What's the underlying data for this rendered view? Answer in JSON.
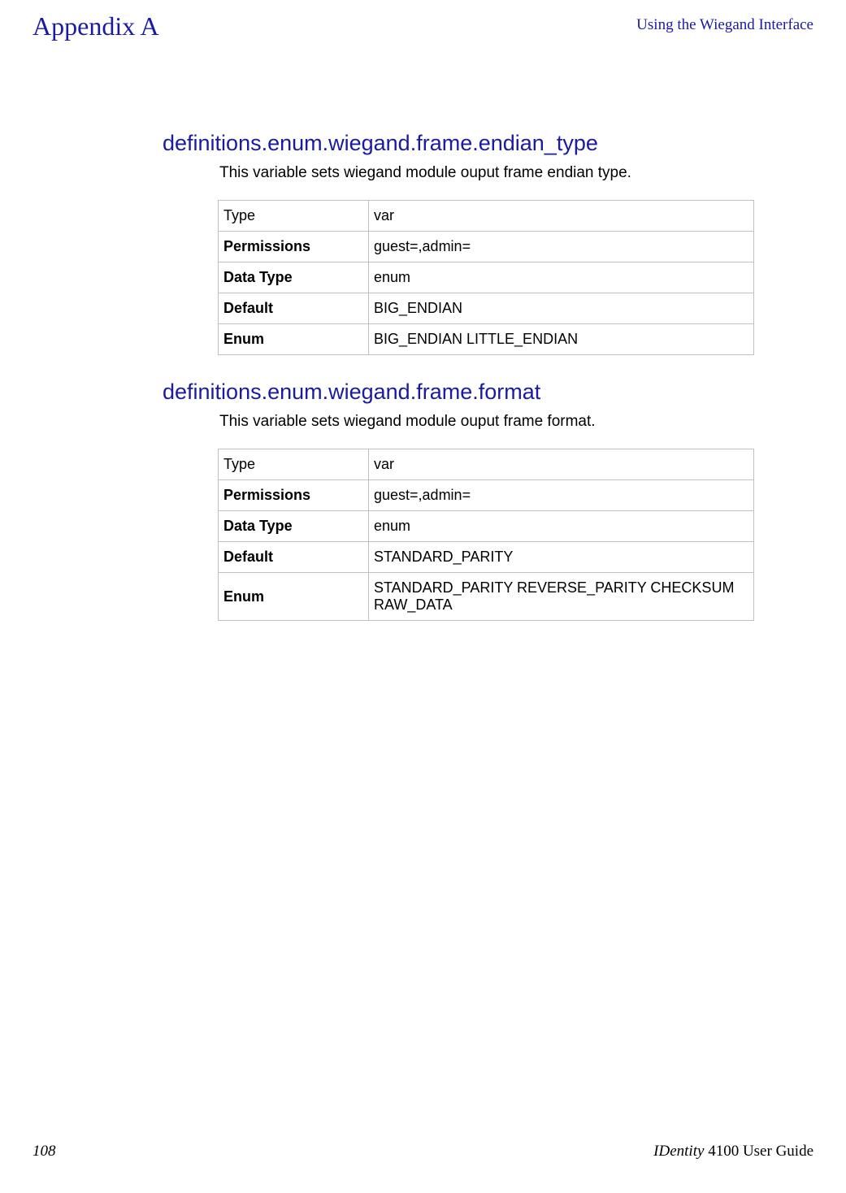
{
  "header": {
    "appendix_title": "Appendix A",
    "right_title": "Using the Wiegand Interface"
  },
  "sections": [
    {
      "heading": "definitions.enum.wiegand.frame.endian_type",
      "description": "This variable sets wiegand module ouput frame endian type.",
      "rows": [
        {
          "label": "Type",
          "value": "var",
          "bold": false
        },
        {
          "label": "Permissions",
          "value": "guest=,admin=",
          "bold": true
        },
        {
          "label": "Data Type",
          "value": "enum",
          "bold": true
        },
        {
          "label": "Default",
          "value": "BIG_ENDIAN",
          "bold": true
        },
        {
          "label": "Enum",
          "value": "BIG_ENDIAN LITTLE_ENDIAN",
          "bold": true
        }
      ]
    },
    {
      "heading": "definitions.enum.wiegand.frame.format",
      "description": "This variable sets wiegand module ouput frame format.",
      "rows": [
        {
          "label": "Type",
          "value": "var",
          "bold": false
        },
        {
          "label": "Permissions",
          "value": "guest=,admin=",
          "bold": true
        },
        {
          "label": "Data Type",
          "value": "enum",
          "bold": true
        },
        {
          "label": "Default",
          "value": "STANDARD_PARITY",
          "bold": true
        },
        {
          "label": "Enum",
          "value": "STANDARD_PARITY REVERSE_PARITY CHECKSUM RAW_DATA",
          "bold": true
        }
      ]
    }
  ],
  "footer": {
    "page_number": "108",
    "guide_text_identity": "IDentity",
    "guide_text_suffix": " 4100 User Guide"
  }
}
